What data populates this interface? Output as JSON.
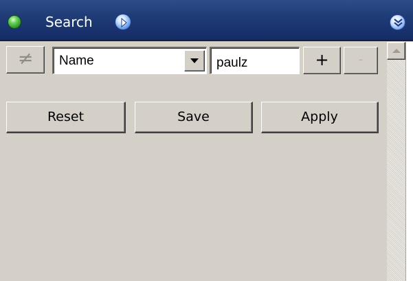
{
  "header": {
    "title": "Search",
    "status_icon": "green-status-dot-icon",
    "nav_icon": "play-arrow-icon",
    "collapse_icon": "double-chevron-down-icon"
  },
  "filter_row": {
    "not_equal_symbol": "≠",
    "field_select_value": "Name",
    "value_input": "paulz",
    "add_label": "+",
    "remove_label": "-"
  },
  "actions": {
    "reset_label": "Reset",
    "save_label": "Save",
    "apply_label": "Apply"
  },
  "colors": {
    "titlebar": "#213e78",
    "panel_background": "#d4d0c8"
  }
}
